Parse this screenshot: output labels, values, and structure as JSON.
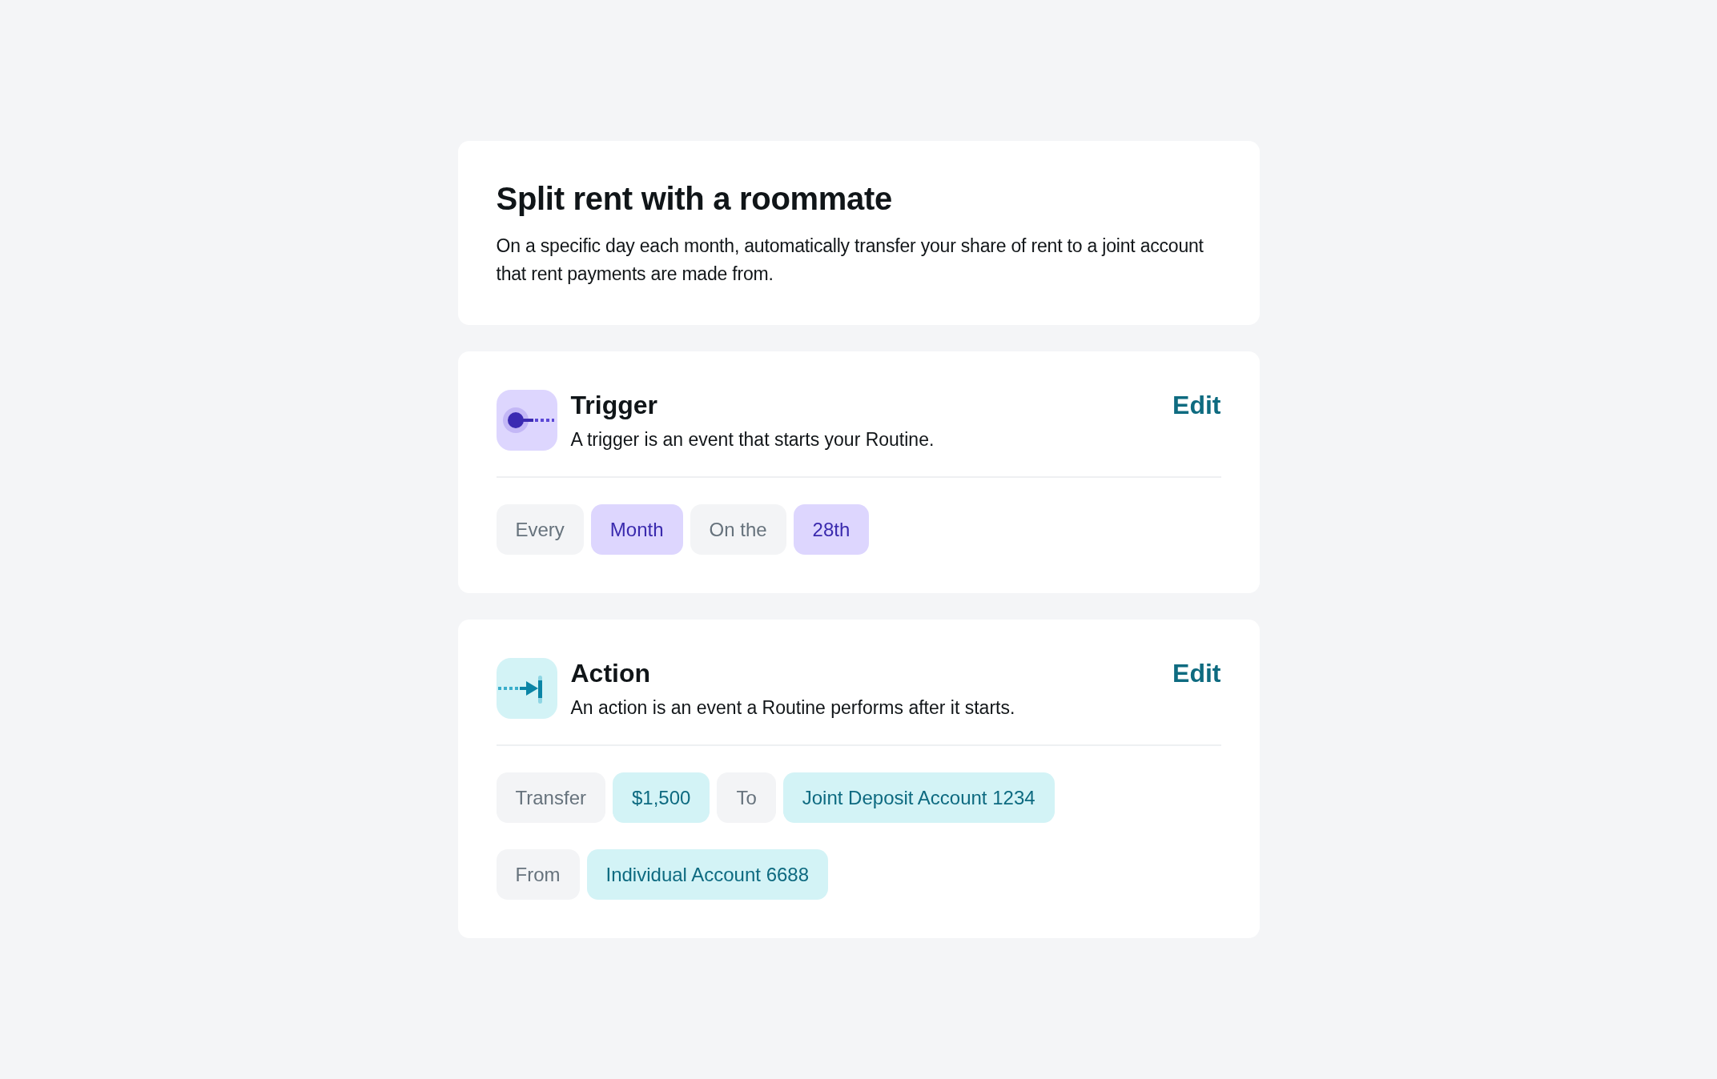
{
  "routine": {
    "title": "Split rent with a roommate",
    "description": "On a specific day each month, automatically transfer your share of rent to a joint account that rent payments are made from."
  },
  "steps": [
    {
      "kind": "trigger",
      "title": "Trigger",
      "description": "A trigger is an event that starts your Routine.",
      "edit_label": "Edit",
      "rows": [
        {
          "chips": [
            {
              "kind": "keyword",
              "text": "Every"
            },
            {
              "kind": "value",
              "text": "Month"
            },
            {
              "kind": "keyword",
              "text": "On the"
            },
            {
              "kind": "value",
              "text": "28th"
            }
          ]
        }
      ]
    },
    {
      "kind": "action",
      "title": "Action",
      "description": "An action is an event a Routine performs after it starts.",
      "edit_label": "Edit",
      "rows": [
        {
          "chips": [
            {
              "kind": "keyword",
              "text": "Transfer"
            },
            {
              "kind": "value",
              "text": "$1,500"
            },
            {
              "kind": "keyword",
              "text": "To"
            },
            {
              "kind": "value",
              "text": "Joint Deposit Account 1234"
            }
          ]
        },
        {
          "chips": [
            {
              "kind": "keyword",
              "text": "From"
            },
            {
              "kind": "value",
              "text": "Individual Account 6688"
            }
          ]
        }
      ]
    }
  ]
}
